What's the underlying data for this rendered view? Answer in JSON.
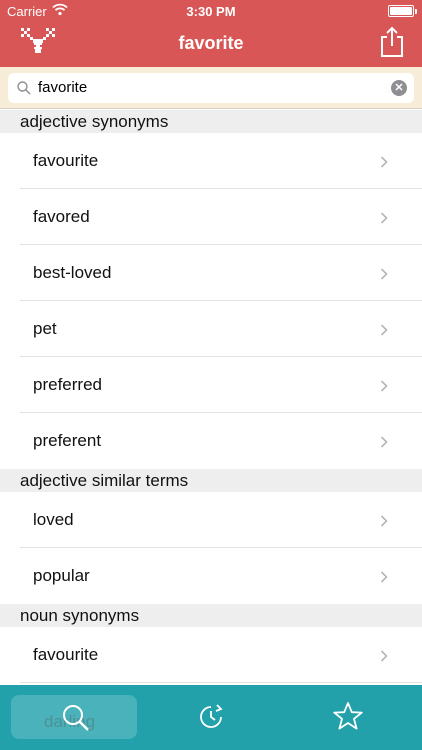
{
  "status_bar": {
    "carrier": "Carrier",
    "time": "3:30 PM"
  },
  "nav": {
    "title": "favorite",
    "logo_icon": "reindeer-icon",
    "share_icon": "share-icon"
  },
  "search": {
    "value": "favorite",
    "clear_icon": "clear-icon"
  },
  "sections": [
    {
      "title": "adjective synonyms",
      "items": [
        "favourite",
        "favored",
        "best-loved",
        "pet",
        "preferred",
        "preferent"
      ]
    },
    {
      "title": "adjective similar terms",
      "items": [
        "loved",
        "popular"
      ]
    },
    {
      "title": "noun synonyms",
      "items": [
        "favourite",
        "darling"
      ]
    }
  ],
  "tabbar": {
    "tabs": [
      {
        "name": "search",
        "icon": "search-icon",
        "selected": true
      },
      {
        "name": "history",
        "icon": "history-icon",
        "selected": false
      },
      {
        "name": "favorites",
        "icon": "star-icon",
        "selected": false
      }
    ]
  },
  "colors": {
    "nav": "#d95656",
    "search_bg": "#f6ecd7",
    "tabbar": "#22a1ab"
  }
}
